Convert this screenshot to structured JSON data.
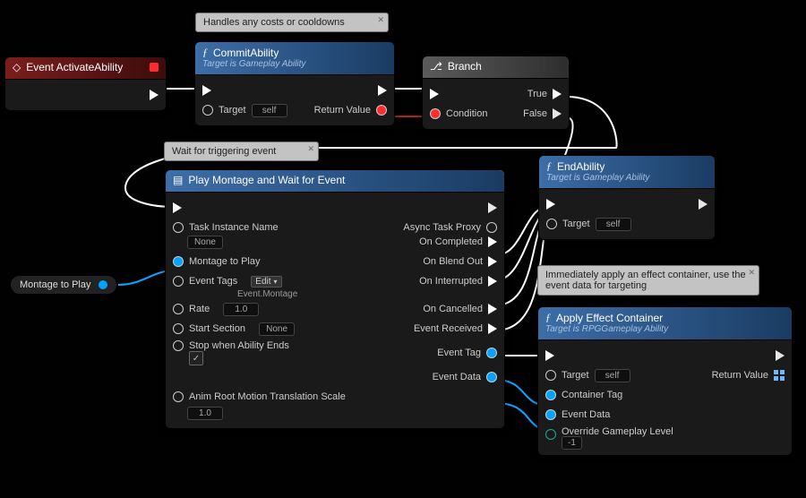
{
  "comments": {
    "commit": "Handles any costs or cooldowns",
    "wait": "Wait for triggering event",
    "apply": "Immediately apply an effect container, use the event data for targeting"
  },
  "nodes": {
    "activate": {
      "title": "Event ActivateAbility"
    },
    "commit": {
      "title": "CommitAbility",
      "subtitle": "Target is Gameplay Ability",
      "pins": {
        "target": "Target",
        "self": "self",
        "rv": "Return Value"
      }
    },
    "branch": {
      "title": "Branch",
      "pins": {
        "cond": "Condition",
        "t": "True",
        "f": "False"
      }
    },
    "end": {
      "title": "EndAbility",
      "subtitle": "Target is Gameplay Ability",
      "pins": {
        "target": "Target",
        "self": "self"
      }
    },
    "play": {
      "title": "Play Montage and Wait for Event",
      "pins": {
        "taskName": "Task Instance Name",
        "taskName_val": "None",
        "montage": "Montage to Play",
        "tags": "Event Tags",
        "tags_btn": "Edit",
        "tags_sub": "Event.Montage",
        "rate": "Rate",
        "rate_val": "1.0",
        "start": "Start Section",
        "start_val": "None",
        "stop": "Stop when Ability Ends",
        "anim": "Anim Root Motion Translation Scale",
        "anim_val": "1.0",
        "proxy": "Async Task Proxy",
        "completed": "On Completed",
        "blend": "On Blend Out",
        "interrupted": "On Interrupted",
        "cancelled": "On Cancelled",
        "received": "Event Received",
        "eventTag": "Event Tag",
        "eventData": "Event Data"
      }
    },
    "apply": {
      "title": "Apply Effect Container",
      "subtitle": "Target is RPGGameplay Ability",
      "pins": {
        "target": "Target",
        "self": "self",
        "ctag": "Container Tag",
        "edata": "Event Data",
        "override": "Override Gameplay Level",
        "override_val": "-1",
        "rv": "Return Value"
      }
    },
    "var": {
      "label": "Montage to Play"
    }
  },
  "colors": {
    "exec": "#ffffff",
    "data": "#00a4ff",
    "bool": "#ff2e2e"
  }
}
